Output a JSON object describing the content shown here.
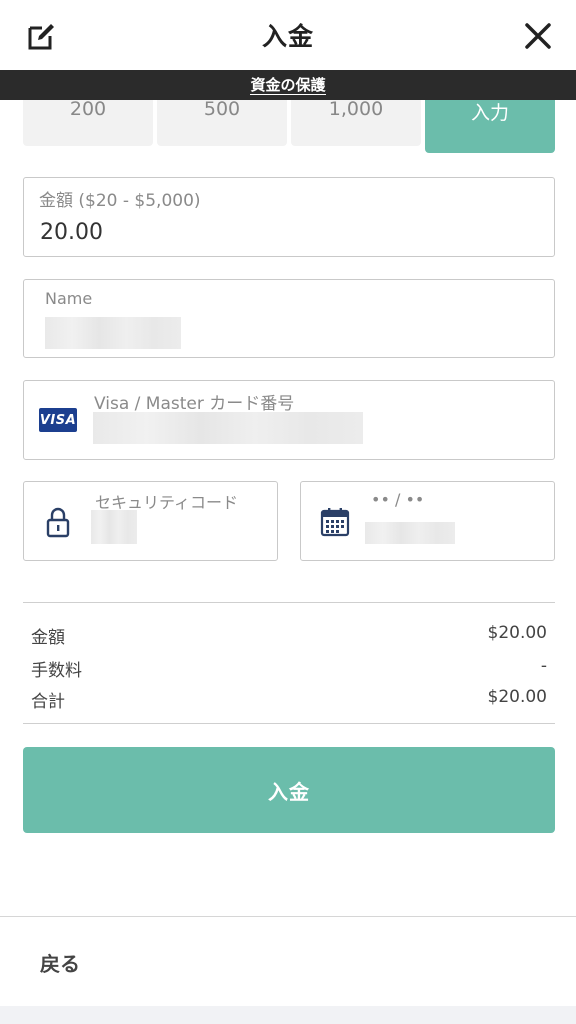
{
  "header": {
    "title": "入金",
    "edit_icon": "edit-icon",
    "close_icon": "close-icon"
  },
  "banner": {
    "text": "資金の保護"
  },
  "presets": [
    {
      "label": "200"
    },
    {
      "label": "500"
    },
    {
      "label": "1,000"
    },
    {
      "label": "入力"
    }
  ],
  "amount_field": {
    "label": "金額 ($20 - $5,000)",
    "value": "20.00"
  },
  "name_field": {
    "label": "Name"
  },
  "card_field": {
    "label": "Visa / Master カード番号",
    "brand": "VISA"
  },
  "security_field": {
    "label": "セキュリティコード"
  },
  "expiry_field": {
    "label": "•• / ••"
  },
  "summary": {
    "rows": [
      {
        "label": "金額",
        "value": "$20.00"
      },
      {
        "label": "手数料",
        "value": "-"
      },
      {
        "label": "合計",
        "value": "$20.00"
      }
    ]
  },
  "submit": {
    "label": "入金"
  },
  "back": {
    "label": "戻る"
  },
  "colors": {
    "accent": "#6bbdab",
    "banner": "#2b2b2b",
    "visa": "#1c3f8f"
  }
}
